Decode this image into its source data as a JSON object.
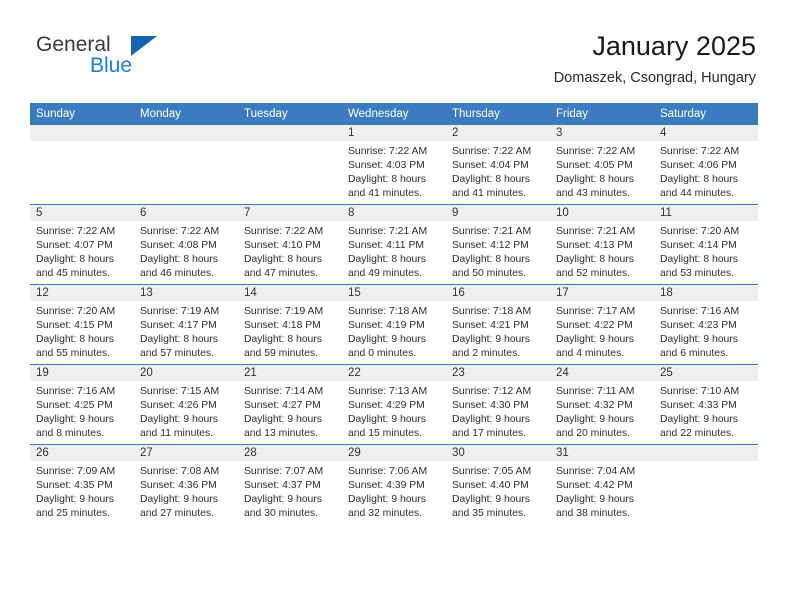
{
  "logo": {
    "line1": "General",
    "line2": "Blue",
    "mark": "triangle-mark"
  },
  "header": {
    "title": "January 2025",
    "subtitle": "Domaszek, Csongrad, Hungary"
  },
  "colors": {
    "header_blue": "#3b7cc0",
    "daynum_gray": "#efefef",
    "logo_blue": "#1b7fd4",
    "logo_dark": "#3a3a3a",
    "text": "#2e2e2e"
  },
  "weekdays": [
    "Sunday",
    "Monday",
    "Tuesday",
    "Wednesday",
    "Thursday",
    "Friday",
    "Saturday"
  ],
  "weeks": [
    [
      {
        "empty": true
      },
      {
        "empty": true
      },
      {
        "empty": true
      },
      {
        "day": "1",
        "sunrise": "Sunrise: 7:22 AM",
        "sunset": "Sunset: 4:03 PM",
        "daylight1": "Daylight: 8 hours",
        "daylight2": "and 41 minutes."
      },
      {
        "day": "2",
        "sunrise": "Sunrise: 7:22 AM",
        "sunset": "Sunset: 4:04 PM",
        "daylight1": "Daylight: 8 hours",
        "daylight2": "and 41 minutes."
      },
      {
        "day": "3",
        "sunrise": "Sunrise: 7:22 AM",
        "sunset": "Sunset: 4:05 PM",
        "daylight1": "Daylight: 8 hours",
        "daylight2": "and 43 minutes."
      },
      {
        "day": "4",
        "sunrise": "Sunrise: 7:22 AM",
        "sunset": "Sunset: 4:06 PM",
        "daylight1": "Daylight: 8 hours",
        "daylight2": "and 44 minutes."
      }
    ],
    [
      {
        "day": "5",
        "sunrise": "Sunrise: 7:22 AM",
        "sunset": "Sunset: 4:07 PM",
        "daylight1": "Daylight: 8 hours",
        "daylight2": "and 45 minutes."
      },
      {
        "day": "6",
        "sunrise": "Sunrise: 7:22 AM",
        "sunset": "Sunset: 4:08 PM",
        "daylight1": "Daylight: 8 hours",
        "daylight2": "and 46 minutes."
      },
      {
        "day": "7",
        "sunrise": "Sunrise: 7:22 AM",
        "sunset": "Sunset: 4:10 PM",
        "daylight1": "Daylight: 8 hours",
        "daylight2": "and 47 minutes."
      },
      {
        "day": "8",
        "sunrise": "Sunrise: 7:21 AM",
        "sunset": "Sunset: 4:11 PM",
        "daylight1": "Daylight: 8 hours",
        "daylight2": "and 49 minutes."
      },
      {
        "day": "9",
        "sunrise": "Sunrise: 7:21 AM",
        "sunset": "Sunset: 4:12 PM",
        "daylight1": "Daylight: 8 hours",
        "daylight2": "and 50 minutes."
      },
      {
        "day": "10",
        "sunrise": "Sunrise: 7:21 AM",
        "sunset": "Sunset: 4:13 PM",
        "daylight1": "Daylight: 8 hours",
        "daylight2": "and 52 minutes."
      },
      {
        "day": "11",
        "sunrise": "Sunrise: 7:20 AM",
        "sunset": "Sunset: 4:14 PM",
        "daylight1": "Daylight: 8 hours",
        "daylight2": "and 53 minutes."
      }
    ],
    [
      {
        "day": "12",
        "sunrise": "Sunrise: 7:20 AM",
        "sunset": "Sunset: 4:15 PM",
        "daylight1": "Daylight: 8 hours",
        "daylight2": "and 55 minutes."
      },
      {
        "day": "13",
        "sunrise": "Sunrise: 7:19 AM",
        "sunset": "Sunset: 4:17 PM",
        "daylight1": "Daylight: 8 hours",
        "daylight2": "and 57 minutes."
      },
      {
        "day": "14",
        "sunrise": "Sunrise: 7:19 AM",
        "sunset": "Sunset: 4:18 PM",
        "daylight1": "Daylight: 8 hours",
        "daylight2": "and 59 minutes."
      },
      {
        "day": "15",
        "sunrise": "Sunrise: 7:18 AM",
        "sunset": "Sunset: 4:19 PM",
        "daylight1": "Daylight: 9 hours",
        "daylight2": "and 0 minutes."
      },
      {
        "day": "16",
        "sunrise": "Sunrise: 7:18 AM",
        "sunset": "Sunset: 4:21 PM",
        "daylight1": "Daylight: 9 hours",
        "daylight2": "and 2 minutes."
      },
      {
        "day": "17",
        "sunrise": "Sunrise: 7:17 AM",
        "sunset": "Sunset: 4:22 PM",
        "daylight1": "Daylight: 9 hours",
        "daylight2": "and 4 minutes."
      },
      {
        "day": "18",
        "sunrise": "Sunrise: 7:16 AM",
        "sunset": "Sunset: 4:23 PM",
        "daylight1": "Daylight: 9 hours",
        "daylight2": "and 6 minutes."
      }
    ],
    [
      {
        "day": "19",
        "sunrise": "Sunrise: 7:16 AM",
        "sunset": "Sunset: 4:25 PM",
        "daylight1": "Daylight: 9 hours",
        "daylight2": "and 8 minutes."
      },
      {
        "day": "20",
        "sunrise": "Sunrise: 7:15 AM",
        "sunset": "Sunset: 4:26 PM",
        "daylight1": "Daylight: 9 hours",
        "daylight2": "and 11 minutes."
      },
      {
        "day": "21",
        "sunrise": "Sunrise: 7:14 AM",
        "sunset": "Sunset: 4:27 PM",
        "daylight1": "Daylight: 9 hours",
        "daylight2": "and 13 minutes."
      },
      {
        "day": "22",
        "sunrise": "Sunrise: 7:13 AM",
        "sunset": "Sunset: 4:29 PM",
        "daylight1": "Daylight: 9 hours",
        "daylight2": "and 15 minutes."
      },
      {
        "day": "23",
        "sunrise": "Sunrise: 7:12 AM",
        "sunset": "Sunset: 4:30 PM",
        "daylight1": "Daylight: 9 hours",
        "daylight2": "and 17 minutes."
      },
      {
        "day": "24",
        "sunrise": "Sunrise: 7:11 AM",
        "sunset": "Sunset: 4:32 PM",
        "daylight1": "Daylight: 9 hours",
        "daylight2": "and 20 minutes."
      },
      {
        "day": "25",
        "sunrise": "Sunrise: 7:10 AM",
        "sunset": "Sunset: 4:33 PM",
        "daylight1": "Daylight: 9 hours",
        "daylight2": "and 22 minutes."
      }
    ],
    [
      {
        "day": "26",
        "sunrise": "Sunrise: 7:09 AM",
        "sunset": "Sunset: 4:35 PM",
        "daylight1": "Daylight: 9 hours",
        "daylight2": "and 25 minutes."
      },
      {
        "day": "27",
        "sunrise": "Sunrise: 7:08 AM",
        "sunset": "Sunset: 4:36 PM",
        "daylight1": "Daylight: 9 hours",
        "daylight2": "and 27 minutes."
      },
      {
        "day": "28",
        "sunrise": "Sunrise: 7:07 AM",
        "sunset": "Sunset: 4:37 PM",
        "daylight1": "Daylight: 9 hours",
        "daylight2": "and 30 minutes."
      },
      {
        "day": "29",
        "sunrise": "Sunrise: 7:06 AM",
        "sunset": "Sunset: 4:39 PM",
        "daylight1": "Daylight: 9 hours",
        "daylight2": "and 32 minutes."
      },
      {
        "day": "30",
        "sunrise": "Sunrise: 7:05 AM",
        "sunset": "Sunset: 4:40 PM",
        "daylight1": "Daylight: 9 hours",
        "daylight2": "and 35 minutes."
      },
      {
        "day": "31",
        "sunrise": "Sunrise: 7:04 AM",
        "sunset": "Sunset: 4:42 PM",
        "daylight1": "Daylight: 9 hours",
        "daylight2": "and 38 minutes."
      },
      {
        "empty": true
      }
    ]
  ]
}
